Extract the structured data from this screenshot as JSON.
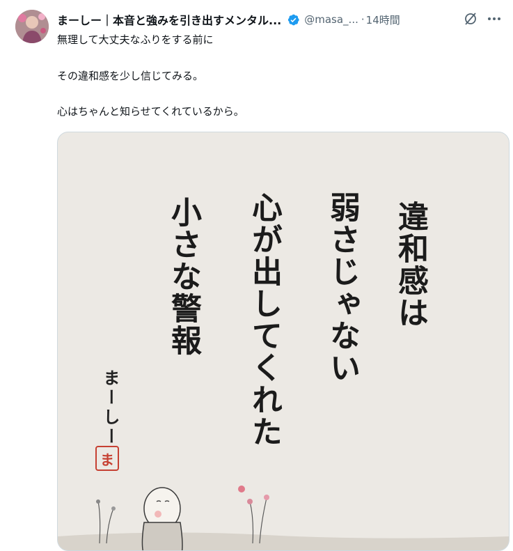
{
  "tweet": {
    "display_name": "まーしー｜本音と強みを引き出すメンタル...",
    "handle": "@masa_...",
    "separator": "·",
    "time": "14時間",
    "lines": [
      "無理して大丈夫なふりをする前に",
      "その違和感を少し信じてみる。",
      "心はちゃんと知らせてくれているから。"
    ]
  },
  "image": {
    "columns": [
      "違和感は",
      "弱さじゃない",
      "心が出してくれた",
      "小さな警報"
    ],
    "author": "まーしー",
    "seal": "ま"
  },
  "icons": {
    "verified": "verified-badge-icon",
    "grok": "grok-icon",
    "more": "more-options-icon"
  },
  "colors": {
    "verified": "#1d9bf0",
    "seal": "#c64032",
    "paper": "#ece9e4"
  }
}
